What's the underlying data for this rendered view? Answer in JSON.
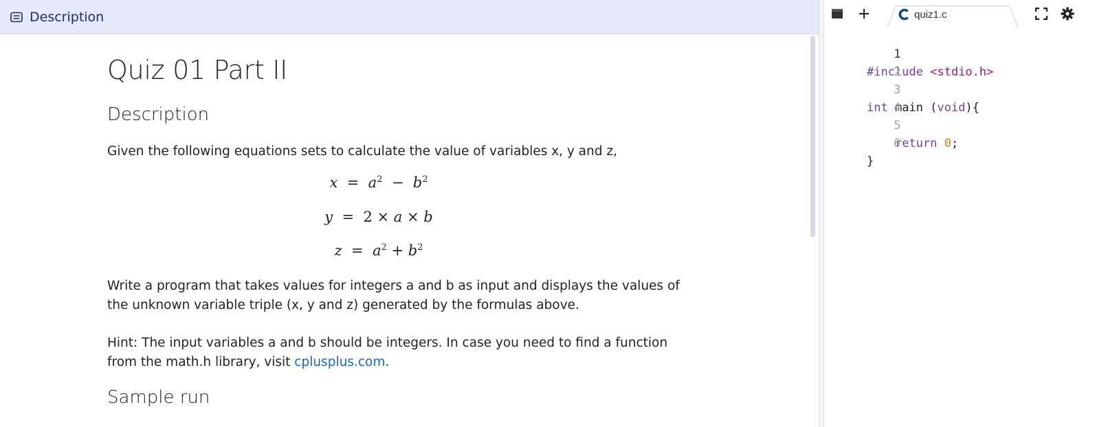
{
  "description_panel": {
    "header_title": "Description",
    "page_title": "Quiz 01 Part II",
    "section_description": "Description",
    "intro": "Given the following equations sets to calculate the value of variables x, y and z,",
    "equations": [
      {
        "lhs": "x",
        "rhs": "a² − b²"
      },
      {
        "lhs": "y",
        "rhs": "2 × a × b"
      },
      {
        "lhs": "z",
        "rhs": "a² + b²"
      }
    ],
    "para_program": "Write a program that takes values for integers a and b as input and displays the values of the unknown variable triple (x, y and z) generated by the formulas above.",
    "hint_text": "Hint: The input variables a and b should be integers. In case you need to find a function from the math.h library, visit ",
    "hint_link": "cplusplus.com",
    "hint_end": ".",
    "section_sample": "Sample run"
  },
  "editor": {
    "tab_label": "quiz1.c",
    "icons": [
      "terminal-icon",
      "plus-icon",
      "c-language-icon",
      "fullscreen-icon",
      "gear-icon"
    ],
    "lines": [
      {
        "n": "1",
        "text": "#include <stdio.h>"
      },
      {
        "n": "2",
        "text": ""
      },
      {
        "n": "3",
        "text": "int main (void){"
      },
      {
        "n": "4",
        "text": ""
      },
      {
        "n": "5",
        "text": "    return 0;"
      },
      {
        "n": "6",
        "text": "}"
      }
    ]
  },
  "colors": {
    "header_bg": "#e6e9fb",
    "header_text": "#1c2a6b",
    "link": "#1a63c7",
    "keyword": "#7a3e9d",
    "string": "#a31575",
    "number": "#e07b1a",
    "scrollbar": "#d9d6ec"
  }
}
